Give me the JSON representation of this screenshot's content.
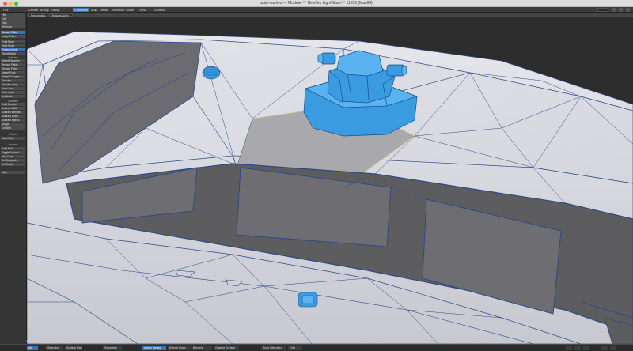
{
  "window": {
    "title": "auto-car.lwo — Modeler™ NewTek LightWave™ 11.6.3 (Mac64)"
  },
  "menubar": {
    "tabs": [
      {
        "label": "File"
      },
      {
        "label": "Create"
      },
      {
        "label": "Modify"
      },
      {
        "label": "Setup"
      },
      {
        "label": "Construct"
      },
      {
        "label": "Map"
      },
      {
        "label": "Detail"
      },
      {
        "label": "Selection"
      },
      {
        "label": "Scale"
      },
      {
        "label": "View"
      },
      {
        "label": "Utilities"
      }
    ],
    "active_tab": "Construct",
    "accent": "#3a73b9"
  },
  "viewport_header": {
    "view": "Perspective",
    "shading": "Textured Wire"
  },
  "sidebar": {
    "top_buttons": [
      "File",
      "Edit",
      "View",
      "Windows"
    ],
    "group1": [
      "Surface Editor",
      "Image Editor"
    ],
    "group2": [
      "Point Mode",
      "Edge Mode",
      "Polygon Mode",
      "Object Mode"
    ],
    "heading_mode": "Selection",
    "group3": [
      "Select Polygons",
      "Reduce Points",
      "Reduce Polys",
      "Merge Polys",
      "Merge Triangles",
      "Dissolve",
      "Dissolve Loop",
      "Band Saw",
      "Weld Scalp",
      "Subdivide"
    ],
    "heading_combine": "Combine",
    "group4": [
      "Solid Boolean",
      "Subtract ABC",
      "Subtract Intersect",
      "Subtract Union",
      "Subtract Stencil",
      "Bridge",
      "Connect"
    ],
    "heading_patch": "Patch",
    "group5": [
      "Auto Patch"
    ],
    "heading_boolean": "Boolean",
    "group6": [
      "Solid Drill",
      "Toggle Subtract",
      "Join Cross",
      "Set Subpatch",
      "Del Subdiv"
    ],
    "heading_more": "More"
  },
  "viewport": {
    "background": "#2d2d2d",
    "mesh_color": "#cfd0d8",
    "wire_color": "#2f4a86",
    "selected_color": "#3b9be0",
    "selected_polygon_color": "#a9a9a9",
    "window_glass_color": "#5d5d60"
  },
  "statusbar": {
    "selection": "Sel",
    "counter": "3",
    "cells": [
      "All",
      "Selection",
      "Front",
      "Symmetry",
      "Action Center",
      "Subpatch",
      "Extend Chain",
      "Borders",
      "Change Surface",
      "Snap Selection",
      "Grid"
    ],
    "hint": "Surface Editor Object Draw"
  }
}
